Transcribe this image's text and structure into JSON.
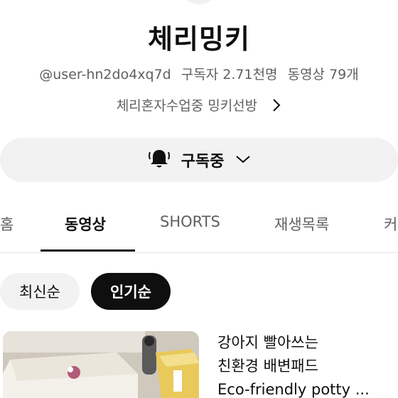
{
  "channel": {
    "name": "체리밍키",
    "handle": "@user-hn2do4xq7d",
    "subscribers": "구독자 2.71천명",
    "video_count": "동영상 79개",
    "description": "체리혼자수업중 밍키선방"
  },
  "subscribe": {
    "label": "구독중"
  },
  "tabs": [
    {
      "label": "홈"
    },
    {
      "label": "동영상"
    },
    {
      "label": "SHORTS"
    },
    {
      "label": "재생목록"
    },
    {
      "label": "커"
    }
  ],
  "chips": [
    {
      "label": "최신순"
    },
    {
      "label": "인기순"
    }
  ],
  "videos": [
    {
      "title_line1": "강아지 빨아쓰는",
      "title_line2": "친환경 배변패드",
      "title_line3": "Eco-friendly potty ..."
    }
  ],
  "colors": {
    "text": "#0f0f0f",
    "secondary": "#606060",
    "chip_bg": "#f2f2f2",
    "active_chip_bg": "#0f0f0f"
  }
}
